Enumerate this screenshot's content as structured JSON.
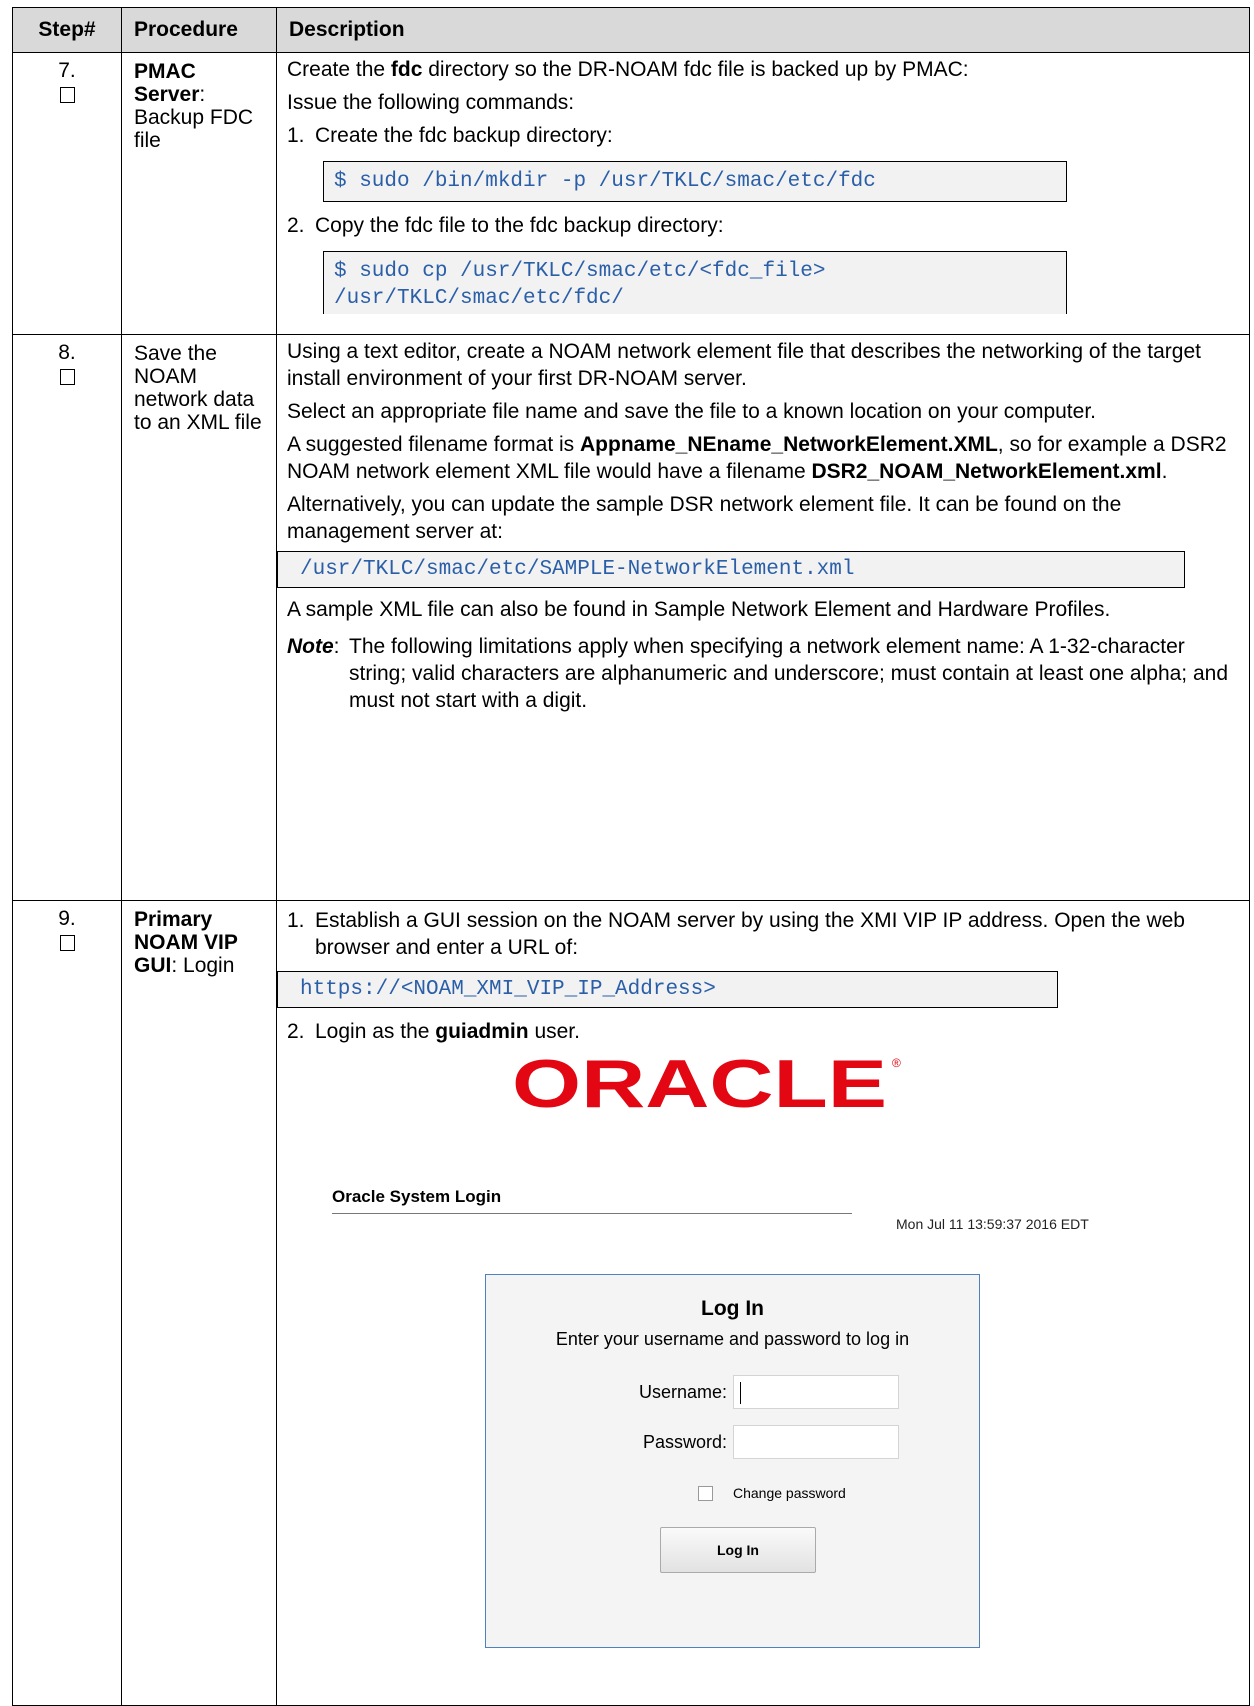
{
  "headers": {
    "step": "Step#",
    "procedure": "Procedure",
    "description": "Description"
  },
  "step7": {
    "number": "7.",
    "procedure_bold": "PMAC Server",
    "procedure_rest": ": Backup FDC file",
    "intro_a": "Create the ",
    "intro_b": "fdc",
    "intro_c": " directory so the DR-NOAM fdc file is backed up by PMAC:",
    "issue": "Issue the following commands:",
    "item1_num": "1.",
    "item1": "Create the fdc backup directory:",
    "cmd1": "$ sudo /bin/mkdir -p /usr/TKLC/smac/etc/fdc",
    "item2_num": "2.",
    "item2": "Copy the fdc file to the fdc backup directory:",
    "cmd2_line1": "$ sudo cp /usr/TKLC/smac/etc/<fdc_file>",
    "cmd2_line2": "/usr/TKLC/smac/etc/fdc/"
  },
  "step8": {
    "number": "8.",
    "procedure": "Save the NOAM network data to an XML file",
    "p1": "Using a text editor, create a NOAM network element file that describes the networking of the target install environment of your first DR-NOAM server.",
    "p2": "Select an appropriate file name and save the file to a known location on your computer.",
    "p3_a": "A suggested filename format is ",
    "p3_b": "Appname_NEname_NetworkElement.XML",
    "p3_c": ", so for example a DSR2 NOAM network element XML file would have a filename ",
    "p3_d": "DSR2_NOAM_NetworkElement.xml",
    "p3_e": ".",
    "p4": "Alternatively, you can update the sample DSR network element file.  It can  be found on the management server at:",
    "path": "/usr/TKLC/smac/etc/SAMPLE-NetworkElement.xml",
    "p5": "A sample XML file can also be found in Sample Network Element and Hardware Profiles.",
    "note_label": "Note",
    "note_colon": ":",
    "note_text": "The following limitations apply when specifying a network element name:  A 1-32-character string; valid characters are alphanumeric and underscore; must contain at least one alpha; and must not start with a digit."
  },
  "step9": {
    "number": "9.",
    "procedure_bold": "Primary NOAM VIP GUI",
    "procedure_rest": ":  Login",
    "item1_num": "1.",
    "item1": "Establish a GUI session on the NOAM server by using the XMI VIP IP address.  Open the web browser and enter a URL of:",
    "url": "https://<NOAM_XMI_VIP_IP_Address>",
    "item2_num": "2.",
    "item2_a": "Login as the ",
    "item2_b": "guiadmin",
    "item2_c": " user.",
    "screenshot": {
      "logo_text": "ORACLE",
      "logo_color": "#e30613",
      "system_title": "Oracle System Login",
      "timestamp": "Mon Jul 11 13:59:37 2016 EDT",
      "box_title": "Log In",
      "box_subtitle": "Enter your username and password to log in",
      "username_label": "Username:",
      "password_label": "Password:",
      "change_password": "Change password",
      "login_button": "Log In"
    }
  }
}
